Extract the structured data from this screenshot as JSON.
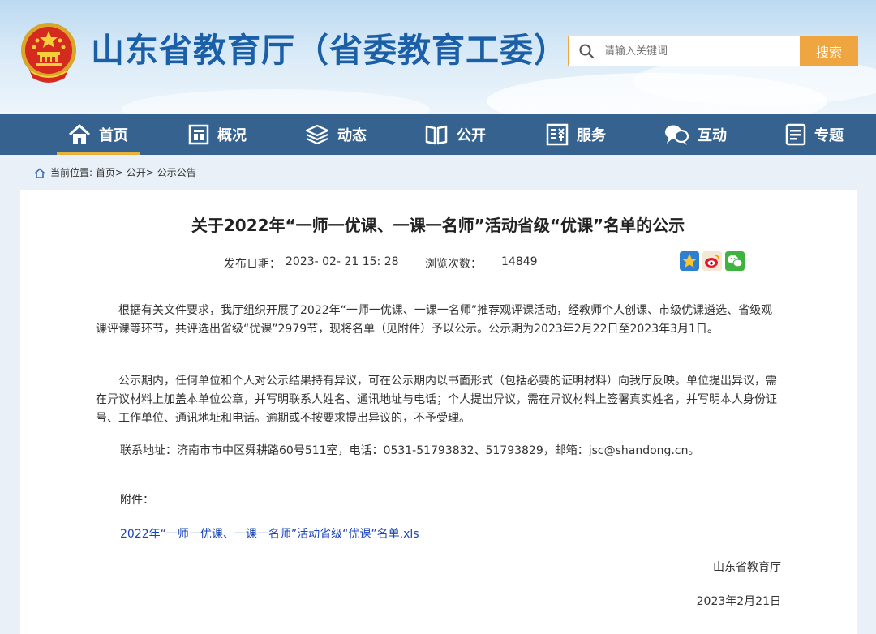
{
  "header": {
    "site_title": "山东省教育厅（省委教育工委）",
    "search_placeholder": "请输入关键词",
    "search_button": "搜索"
  },
  "nav": {
    "items": [
      {
        "label": "首页",
        "icon": "home-icon"
      },
      {
        "label": "概况",
        "icon": "building-icon"
      },
      {
        "label": "动态",
        "icon": "layers-icon"
      },
      {
        "label": "公开",
        "icon": "book-icon"
      },
      {
        "label": "服务",
        "icon": "service-icon"
      },
      {
        "label": "互动",
        "icon": "chat-icon"
      },
      {
        "label": "专题",
        "icon": "document-icon"
      }
    ],
    "active_index": 0
  },
  "breadcrumb": {
    "prefix": "当前位置:",
    "path": "首页> 公开> 公示公告"
  },
  "article": {
    "title": "关于2022年“一师一优课、一课一名师”活动省级“优课”名单的公示",
    "date_label": "发布日期：",
    "date_value": "2023- 02- 21 15: 28",
    "views_label": "浏览次数：",
    "views_value": "14849",
    "share_icons": [
      "favorite-icon",
      "weibo-icon",
      "wechat-icon"
    ],
    "para1": "根据有关文件要求，我厅组织开展了2022年“一师一优课、一课一名师”推荐观评课活动，经教师个人创课、市级优课遴选、省级观课评课等环节，共评选出省级“优课”2979节，现将名单（见附件）予以公示。公示期为2023年2月22日至2023年3月1日。",
    "para2": "公示期内，任何单位和个人对公示结果持有异议，可在公示期内以书面形式（包括必要的证明材料）向我厅反映。单位提出异议，需在异议材料上加盖本单位公章，并写明联系人姓名、通讯地址与电话；个人提出异议，需在异议材料上签署真实姓名，并写明本人身份证号、工作单位、通讯地址和电话。逾期或不按要求提出异议的，不予受理。",
    "contact": "联系地址：济南市市中区舜耕路60号511室，电话：0531-51793832、51793829，邮箱：jsc@shandong.cn。",
    "attachment_label": "附件：",
    "attachment_link": "2022年“一师一优课、一课一名师”活动省级“优课”名单.xls",
    "signature": "山东省教育厅",
    "sign_date": "2023年2月21日"
  },
  "colors": {
    "nav_bg": "#35628f",
    "title_blue": "#1a5fa8",
    "search_orange": "#f0a640",
    "link_blue": "#1a44b8"
  }
}
